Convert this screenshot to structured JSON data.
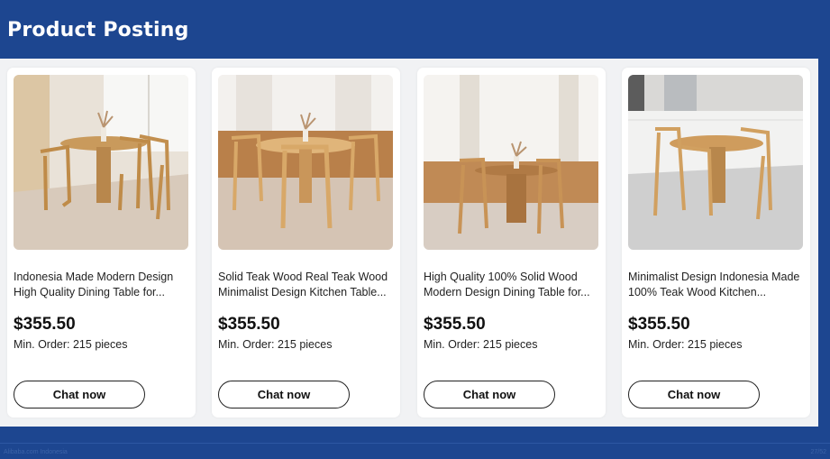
{
  "header": {
    "title": "Product Posting"
  },
  "products": [
    {
      "name": "Indonesia Made Modern Design High Quality Dining Table for...",
      "price": "$355.50",
      "min_order": "Min. Order: 215 pieces",
      "button": "Chat now"
    },
    {
      "name": "Solid Teak Wood Real Teak Wood Minimalist Design Kitchen Table...",
      "price": "$355.50",
      "min_order": "Min. Order: 215 pieces",
      "button": "Chat now"
    },
    {
      "name": "High Quality 100% Solid Wood Modern Design Dining Table for...",
      "price": "$355.50",
      "min_order": "Min. Order: 215 pieces",
      "button": "Chat now"
    },
    {
      "name": "Minimalist Design Indonesia Made 100% Teak Wood Kitchen...",
      "price": "$355.50",
      "min_order": "Min. Order: 215 pieces",
      "button": "Chat now"
    }
  ],
  "footer": {
    "left": "Alibaba.com Indonesia",
    "right": "27/52"
  },
  "colors": {
    "brand_blue": "#1d4690",
    "card_bg": "#ffffff",
    "content_bg": "#f1f2f4"
  }
}
